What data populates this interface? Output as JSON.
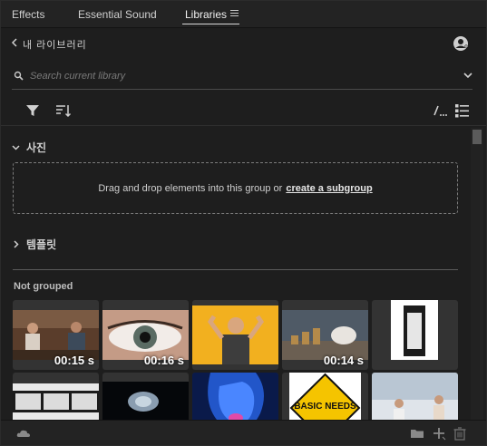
{
  "tabs": [
    {
      "label": "Effects"
    },
    {
      "label": "Essential Sound"
    },
    {
      "label": "Libraries"
    }
  ],
  "library": {
    "name": "내 라이브러리"
  },
  "search": {
    "placeholder": "Search current library"
  },
  "groups": {
    "photos": {
      "label": "사진"
    },
    "templates": {
      "label": "템플릿"
    }
  },
  "dropzone": {
    "text": "Drag and drop elements into this group or",
    "link": "create a subgroup"
  },
  "not_grouped": {
    "label": "Not grouped"
  },
  "items": [
    {
      "duration": "00:15 s"
    },
    {
      "duration": "00:16 s"
    },
    {
      "duration": ""
    },
    {
      "duration": "00:14 s"
    },
    {
      "duration": ""
    },
    {
      "duration": ""
    },
    {
      "duration": ""
    },
    {
      "duration": ""
    },
    {
      "duration": "",
      "sign_text": "BASIC NEEDS"
    },
    {
      "duration": ""
    }
  ],
  "colors": {
    "accent": "#d9d9d9",
    "panel": "#1e1e1e",
    "tab_bar": "#232323"
  }
}
